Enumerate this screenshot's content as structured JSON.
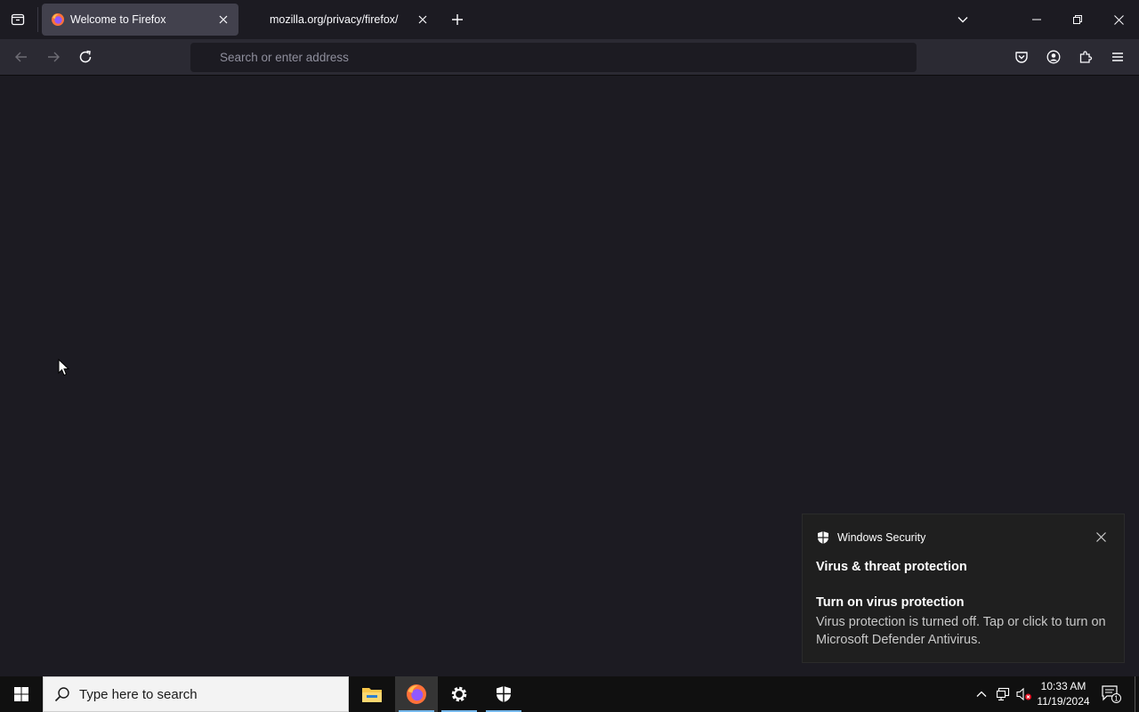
{
  "browser": {
    "tabs": [
      {
        "title": "Welcome to Firefox",
        "active": true
      },
      {
        "title": "mozilla.org/privacy/firefox/",
        "active": false
      }
    ],
    "urlbar": {
      "placeholder": "Search or enter address",
      "value": ""
    }
  },
  "notification": {
    "app_name": "Windows Security",
    "title": "Virus & threat protection",
    "subtitle": "Turn on virus protection",
    "body": "Virus protection is turned off. Tap or click to turn on Microsoft Defender Antivirus."
  },
  "taskbar": {
    "search_placeholder": "Type here to search",
    "time": "10:33 AM",
    "date": "11/19/2024",
    "notification_count": "1"
  },
  "colors": {
    "background": "#1c1b22",
    "toolbar": "#2b2a33",
    "active_tab": "#42414d",
    "taskbar_accent": "#76b9ed"
  }
}
